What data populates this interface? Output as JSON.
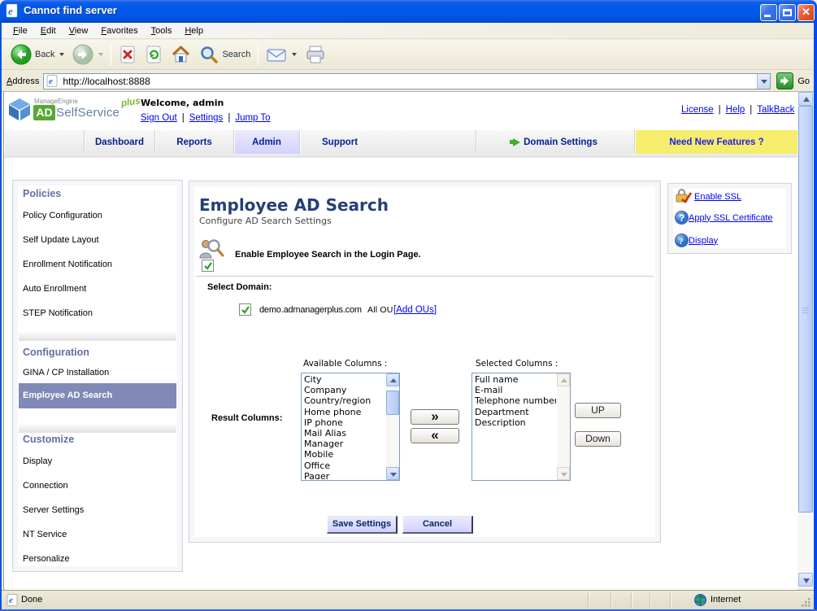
{
  "window": {
    "title": "Cannot find server"
  },
  "menu": {
    "items": [
      "File",
      "Edit",
      "View",
      "Favorites",
      "Tools",
      "Help"
    ]
  },
  "toolbar": {
    "back": "Back",
    "search": "Search"
  },
  "address": {
    "label": "Address",
    "url": "http://localhost:8888",
    "go": "Go"
  },
  "header": {
    "logo": {
      "brand": "ManageEngine",
      "ad": "AD",
      "product": "SelfService",
      "plus": "plus"
    },
    "welcome": "Welcome, admin",
    "links": [
      "Sign Out",
      "Settings",
      "Jump To"
    ],
    "top_links": [
      "License",
      "Help",
      "TalkBack"
    ]
  },
  "nav": {
    "tabs": [
      "Dashboard",
      "Reports",
      "Admin",
      "Support"
    ],
    "domain_settings": "Domain Settings",
    "need_features": "Need New Features ?"
  },
  "sidebar": {
    "sections": [
      {
        "title": "Policies",
        "items": [
          "Policy Configuration",
          "Self Update Layout",
          "Enrollment Notification",
          "Auto Enrollment",
          "STEP Notification"
        ]
      },
      {
        "title": "Configuration",
        "items": [
          "GINA / CP Installation",
          "Employee AD Search"
        ]
      },
      {
        "title": "Customize",
        "items": [
          "Display",
          "Connection",
          "Server Settings",
          "NT Service",
          "Personalize"
        ]
      }
    ],
    "selected_item": "Employee AD Search"
  },
  "main": {
    "title": "Employee AD Search",
    "subtitle": "Configure AD Search Settings",
    "enable_label": "Enable Employee Search in the Login Page.",
    "select_domain_label": "Select Domain:",
    "domain": "demo.admanagerplus.com",
    "all_ou": "All OU",
    "add_ous": "[Add OUs]",
    "result_columns_label": "Result Columns:",
    "available_label": "Available Columns :",
    "selected_label": "Selected Columns :",
    "available": [
      "City",
      "Company",
      "Country/region",
      "Home phone",
      "IP phone",
      "Mail Alias",
      "Manager",
      "Mobile",
      "Office",
      "Pager"
    ],
    "selected": [
      "Full name",
      "E-mail",
      "Telephone number",
      "Department",
      "Description"
    ],
    "buttons": {
      "add": "»",
      "remove": "«",
      "up": "UP",
      "down": "Down",
      "save": "Save Settings",
      "cancel": "Cancel"
    }
  },
  "rightbox": {
    "links": [
      "Enable SSL",
      "Apply SSL Certificate",
      "Display"
    ]
  },
  "status": {
    "text": "Done",
    "zone": "Internet"
  },
  "colors": {
    "titlebar": "#005aec",
    "accent_yellow": "#f5ed6b",
    "active_tab": "#d2d1ff",
    "selected_nav": "#818ab6",
    "link": "#0000ee",
    "title_text": "#254075"
  }
}
